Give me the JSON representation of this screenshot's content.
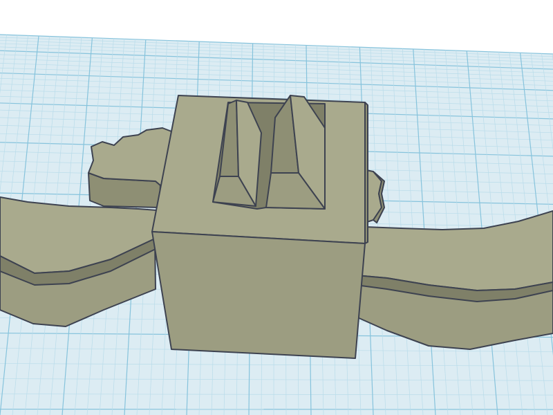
{
  "colors": {
    "background": "#ffffff",
    "workplane": "#dcecf3",
    "grid_minor": "#b9dcea",
    "grid_major": "#86c3dc",
    "model_top": "#a9aa8d",
    "model_front": "#9c9d81",
    "model_side": "#8e8f74",
    "model_shadow": "#7f8068",
    "model_outline": "#3d4250"
  },
  "scene": {
    "model_name": "",
    "shapes": [
      "left-wing",
      "right-wing",
      "cube-body",
      "left-slot-ridge",
      "right-slot-ridge"
    ]
  }
}
